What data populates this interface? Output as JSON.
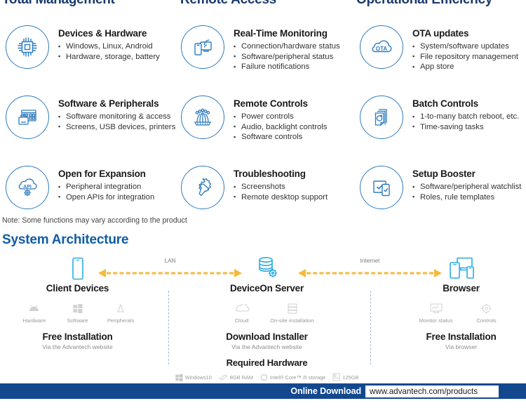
{
  "columns": [
    {
      "heading": "Total Management"
    },
    {
      "heading": "Remote Access"
    },
    {
      "heading": "Operational Efficiency"
    }
  ],
  "features": [
    {
      "icon": "chip-icon",
      "title": "Devices & Hardware",
      "items": [
        "Windows, Linux, Android",
        "Hardware, storage, battery"
      ]
    },
    {
      "icon": "real-time-monitoring-icon",
      "title": "Real-Time Monitoring",
      "items": [
        "Connection/hardware status",
        "Software/peripheral status",
        "Failure notifications"
      ]
    },
    {
      "icon": "ota-cloud-icon",
      "title": "OTA updates",
      "items": [
        "System/software updates",
        "File repository management",
        "App store"
      ]
    },
    {
      "icon": "software-peripherals-icon",
      "title": "Software & Peripherals",
      "items": [
        "Software monitoring & access",
        "Screens, USB devices, printers"
      ]
    },
    {
      "icon": "remote-controls-icon",
      "title": "Remote Controls",
      "items": [
        "Power controls",
        "Audio, backlight controls",
        "Software controls"
      ]
    },
    {
      "icon": "batch-controls-icon",
      "title": "Batch Controls",
      "items": [
        "1-to-many batch reboot, etc.",
        "Time-saving tasks"
      ]
    },
    {
      "icon": "api-cloud-icon",
      "title": "Open for Expansion",
      "items": [
        "Peripheral integration",
        "Open APIs for integration"
      ]
    },
    {
      "icon": "troubleshooting-gear-wrench-icon",
      "title": "Troubleshooting",
      "items": [
        "Screenshots",
        "Remote desktop support"
      ]
    },
    {
      "icon": "setup-booster-icon",
      "title": "Setup Booster",
      "items": [
        "Software/peripheral watchlist",
        "Roles, rule templates"
      ]
    }
  ],
  "note": "Note: Some functions may vary according to the product",
  "architecture": {
    "title": "System Architecture",
    "nodes": [
      {
        "icon": "smartphone-icon",
        "label": "Client Devices",
        "sub_items": [
          {
            "icon": "android-icon",
            "label": "Hardware"
          },
          {
            "icon": "windows-icon",
            "label": "Software"
          },
          {
            "icon": "peripheral-icon",
            "label": "Peripherals"
          }
        ],
        "install_title": "Free Installation",
        "install_sub": "Via the Advantech website"
      },
      {
        "icon": "database-server-icon",
        "label": "DeviceOn Server",
        "sub_items": [
          {
            "icon": "cloud-icon",
            "label": "Cloud"
          },
          {
            "icon": "onsite-server-icon",
            "label": "On-site installation"
          }
        ],
        "install_title": "Download Installer",
        "install_sub": "Via the Advantech website",
        "requirements_title": "Required Hardware",
        "requirements": [
          {
            "icon": "windows-icon",
            "label": "Windows10"
          },
          {
            "icon": "ram-icon",
            "label": "8GB RAM"
          },
          {
            "icon": "cpu-icon",
            "label": "Intel® Core™ i5 storage"
          },
          {
            "icon": "storage-icon",
            "label": "125GB"
          }
        ]
      },
      {
        "icon": "browser-devices-icon",
        "label": "Browser",
        "sub_items": [
          {
            "icon": "monitor-status-icon",
            "label": "Monitor status"
          },
          {
            "icon": "controls-gear-icon",
            "label": "Controls"
          }
        ],
        "install_title": "Free Installation",
        "install_sub": "Via browser"
      }
    ],
    "links": [
      {
        "label": "LAN"
      },
      {
        "label": "Internet"
      }
    ]
  },
  "footer": {
    "label": "Online Download",
    "url": "www.advantech.com/products"
  },
  "colors": {
    "brand_blue": "#13488f",
    "heading_navy": "#1b3a6b",
    "accent_blue": "#0f5ca8",
    "icon_blue": "#2e7bbd",
    "arrow_yellow": "#f5b93b"
  }
}
